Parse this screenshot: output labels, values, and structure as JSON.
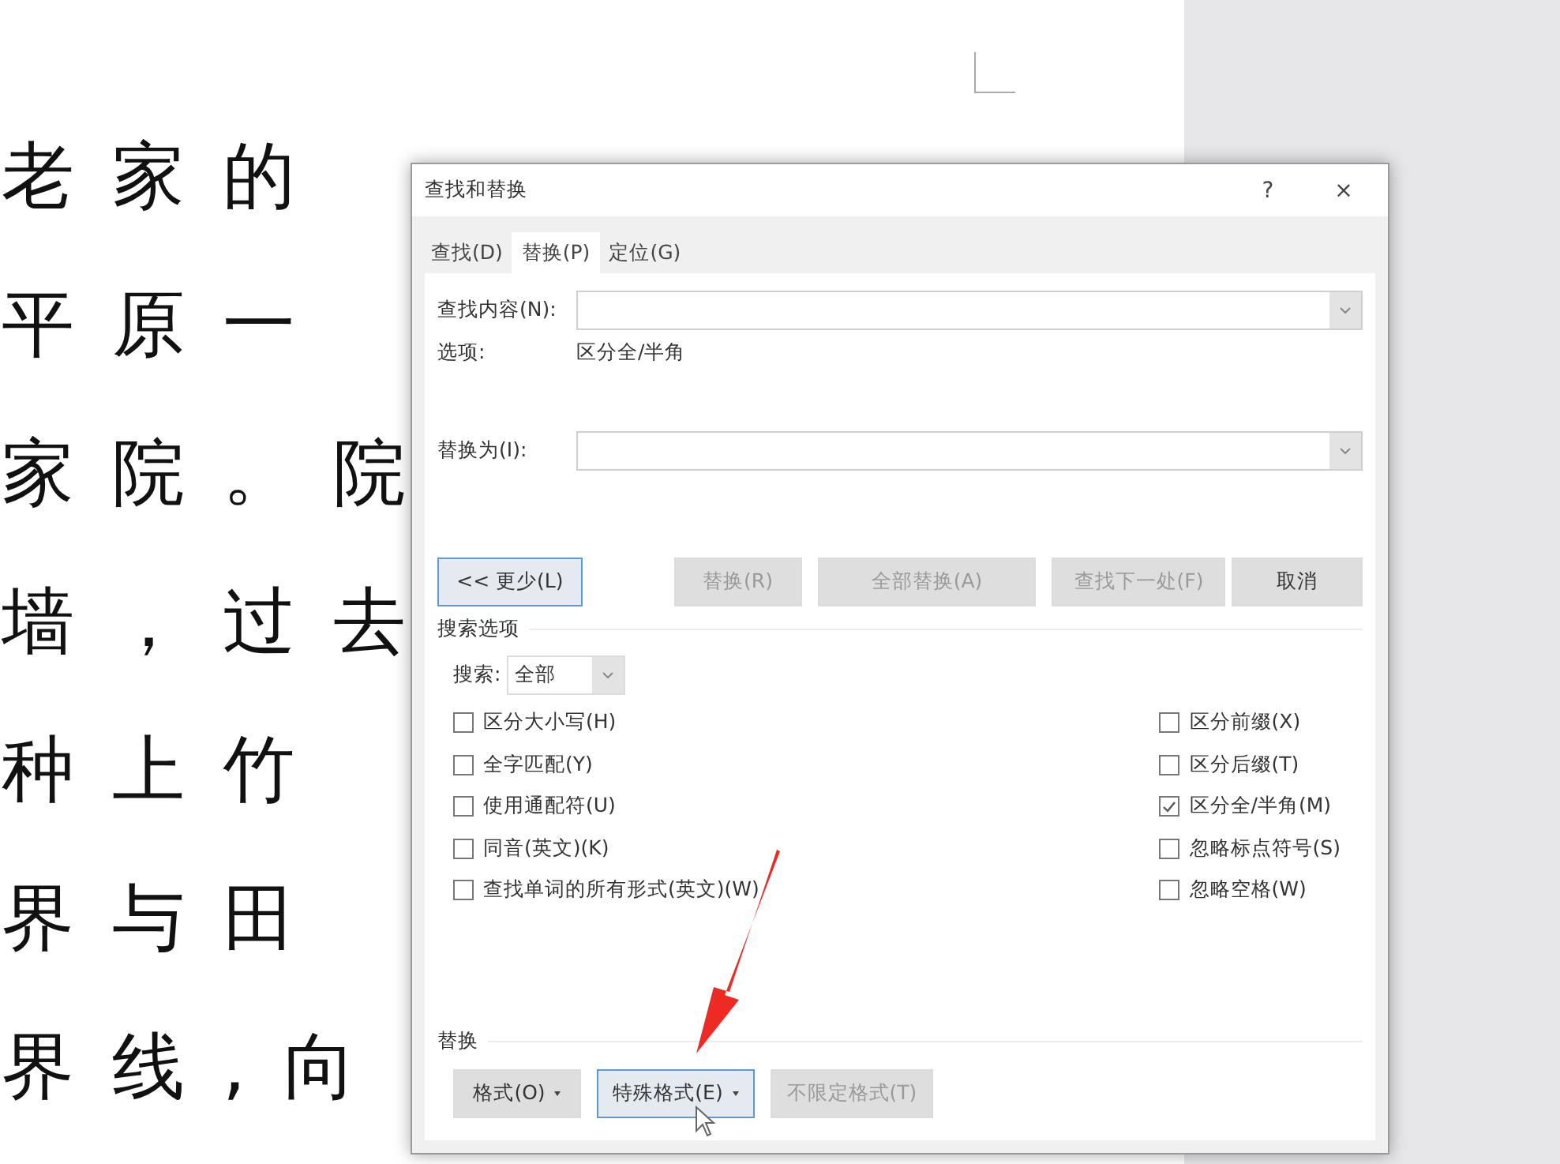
{
  "document": {
    "lines": [
      "老家的",
      "平原一",
      "家院。院",
      "墙，过去",
      "种上竹",
      "界与田",
      "界线,向"
    ]
  },
  "dialog": {
    "title": "查找和替换",
    "help": "?",
    "close": "×",
    "tabs": [
      {
        "label": "查找(D)",
        "selected": false
      },
      {
        "label": "替换(P)",
        "selected": true
      },
      {
        "label": "定位(G)",
        "selected": false
      }
    ],
    "find": {
      "label": "查找内容(N):",
      "options_label": "选项:",
      "options_value": "区分全/半角"
    },
    "replace": {
      "label": "替换为(I):"
    },
    "buttons": [
      {
        "label": "<< 更少(L)",
        "disabled": false,
        "focused": true
      },
      {
        "label": "替换(R)",
        "disabled": true,
        "focused": false
      },
      {
        "label": "全部替换(A)",
        "disabled": true,
        "focused": false
      },
      {
        "label": "查找下一处(F)",
        "disabled": true,
        "focused": false
      },
      {
        "label": "取消",
        "disabled": false,
        "focused": false
      }
    ],
    "search_options": {
      "heading": "搜索选项",
      "search_label": "搜索:",
      "search_value": "全部"
    },
    "left_options": [
      {
        "label": "区分大小写(H)",
        "checked": false
      },
      {
        "label": "全字匹配(Y)",
        "checked": false
      },
      {
        "label": "使用通配符(U)",
        "checked": false
      },
      {
        "label": "同音(英文)(K)",
        "checked": false
      },
      {
        "label": "查找单词的所有形式(英文)(W)",
        "checked": false
      }
    ],
    "right_options": [
      {
        "label": "区分前缀(X)",
        "checked": false
      },
      {
        "label": "区分后缀(T)",
        "checked": false
      },
      {
        "label": "区分全/半角(M)",
        "checked": true
      },
      {
        "label": "忽略标点符号(S)",
        "checked": false
      },
      {
        "label": "忽略空格(W)",
        "checked": false
      }
    ],
    "replace_section": {
      "heading": "替换",
      "buttons": [
        {
          "label": "格式(O)",
          "disabled": false,
          "focused": false,
          "dropdown": true
        },
        {
          "label": "特殊格式(E)",
          "disabled": false,
          "focused": true,
          "dropdown": true
        },
        {
          "label": "不限定格式(T)",
          "disabled": true,
          "focused": false,
          "dropdown": false
        }
      ]
    }
  }
}
